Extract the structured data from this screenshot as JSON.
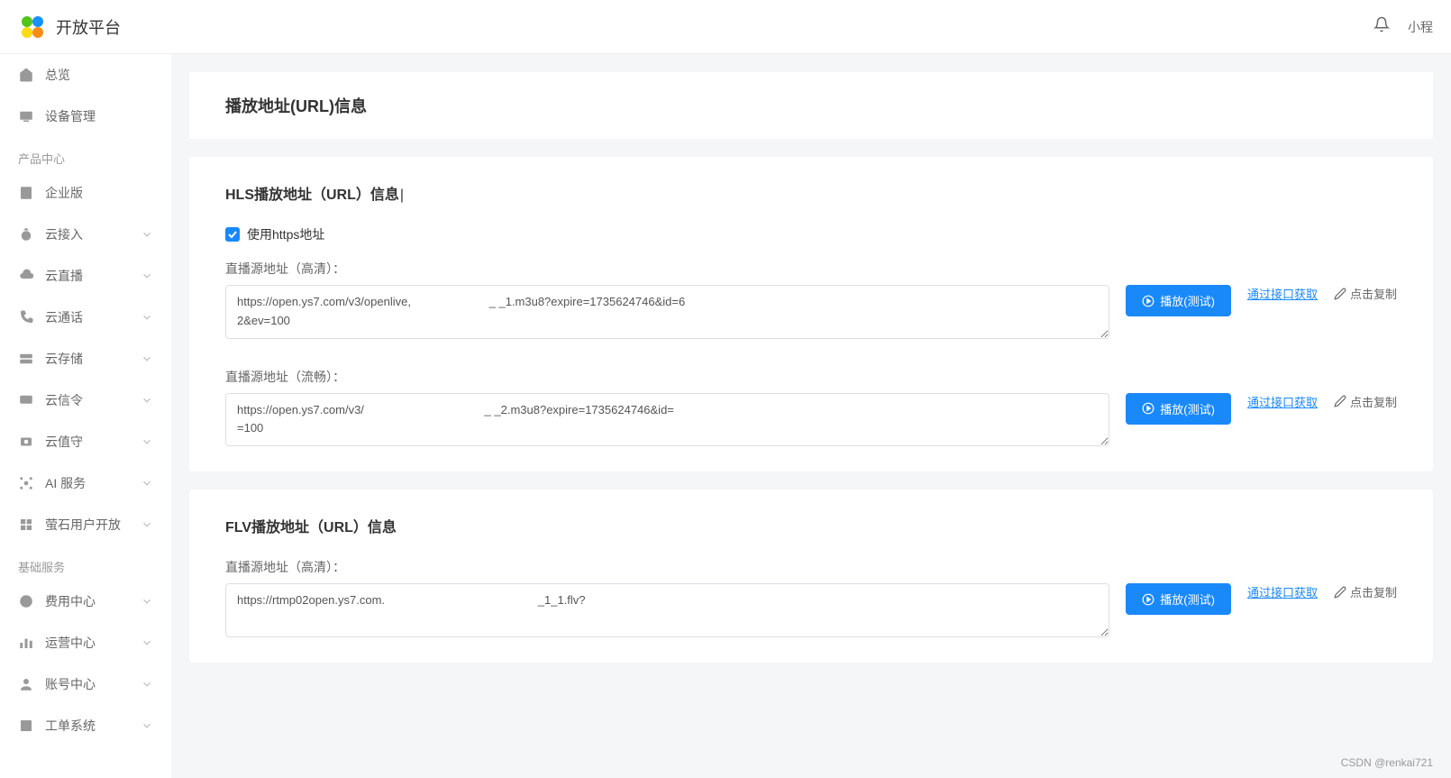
{
  "header": {
    "title": "开放平台",
    "user": "小程"
  },
  "sidebar": {
    "items_top": [
      {
        "icon": "home",
        "label": "总览",
        "expandable": false
      },
      {
        "icon": "device",
        "label": "设备管理",
        "expandable": false
      }
    ],
    "section1": "产品中心",
    "items_mid": [
      {
        "icon": "enterprise",
        "label": "企业版",
        "expandable": false
      },
      {
        "icon": "cloud-access",
        "label": "云接入",
        "expandable": true
      },
      {
        "icon": "cloud-live",
        "label": "云直播",
        "expandable": true
      },
      {
        "icon": "cloud-call",
        "label": "云通话",
        "expandable": true
      },
      {
        "icon": "cloud-storage",
        "label": "云存储",
        "expandable": true
      },
      {
        "icon": "cloud-msg",
        "label": "云信令",
        "expandable": true
      },
      {
        "icon": "cloud-watch",
        "label": "云值守",
        "expandable": true
      },
      {
        "icon": "ai",
        "label": "AI 服务",
        "expandable": true
      },
      {
        "icon": "user-open",
        "label": "萤石用户开放",
        "expandable": true
      }
    ],
    "section2": "基础服务",
    "items_bot": [
      {
        "icon": "fee",
        "label": "费用中心",
        "expandable": true
      },
      {
        "icon": "ops",
        "label": "运营中心",
        "expandable": true
      },
      {
        "icon": "account",
        "label": "账号中心",
        "expandable": true
      },
      {
        "icon": "ticket",
        "label": "工单系统",
        "expandable": true
      }
    ]
  },
  "page": {
    "title": "播放地址(URL)信息"
  },
  "hls": {
    "title": "HLS播放地址（URL）信息",
    "checkbox_label": "使用https地址",
    "hd_label": "直播源地址（高清）：",
    "hd_url": "https://open.ys7.com/v3/openlive,                        _ _1.m3u8?expire=1735624746&id=6                                                                                                                                                 2&ev=100",
    "sd_label": "直播源地址（流畅）：",
    "sd_url": "https://open.ys7.com/v3/                                     _ _2.m3u8?expire=1735624746&id=                                                                                                                                                   =100"
  },
  "flv": {
    "title": "FLV播放地址（URL）信息",
    "hd_label": "直播源地址（高清）：",
    "hd_url": "https://rtmp02open.ys7.com.                                               _1_1.flv?"
  },
  "actions": {
    "play": "播放(测试)",
    "api": "通过接口获取",
    "copy": "点击复制"
  },
  "watermark": "CSDN @renkai721"
}
